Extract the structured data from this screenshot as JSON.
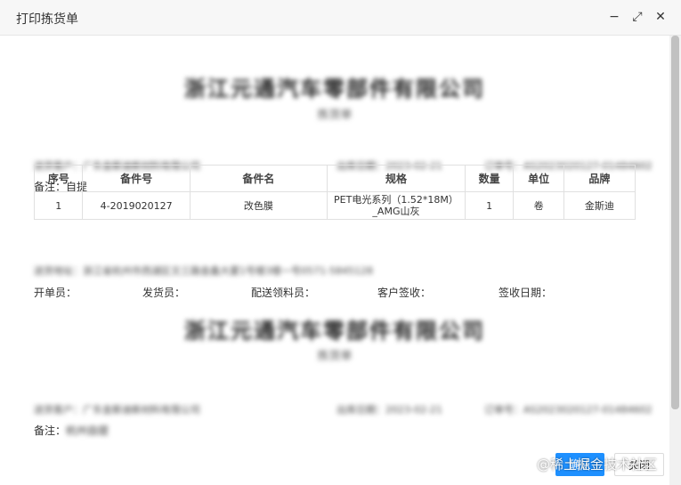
{
  "window": {
    "title": "打印拣货单",
    "minimize_glyph": "−",
    "maximize_glyph": "⤢",
    "close_glyph": "✕"
  },
  "sheets": [
    {
      "company": "浙江元通汽车零部件有限公司",
      "doc_name": "拣货单",
      "delivery_to": "送货客户：广东金斯迪新材料有限公司",
      "date": "出库日期：2023-02-21",
      "order_no": "订单号：AS2023020127-01484602",
      "note_label": "备注：",
      "note_value": "自提",
      "address": "送货地址：浙江省杭州市西湖区文三路金鑫大厦1号楼3楼一号0571-5845128",
      "footer": {
        "issuer": "开单员：",
        "shipper": "发货员：",
        "picker": "配送领料员：",
        "customer_sign": "客户签收：",
        "sign_date": "签收日期："
      }
    },
    {
      "company": "浙江元通汽车零部件有限公司",
      "doc_name": "拣货单",
      "delivery_to": "送货客户：广东金斯迪新材料有限公司",
      "date": "出库日期：2023-02-21",
      "order_no": "订单号：AS2023020127-01484602",
      "note_label": "备注：",
      "note_value": "杭州自提"
    }
  ],
  "table": {
    "headers": [
      "序号",
      "备件号",
      "备件名",
      "规格",
      "数量",
      "单位",
      "品牌"
    ],
    "rows": [
      {
        "index": "1",
        "part_no": "4-2019020127",
        "part_name": "改色膜",
        "spec_line1": "PET电光系列（1.52*18M）",
        "spec_line2": "_AMG山灰",
        "qty": "1",
        "unit": "卷",
        "brand": "金斯迪"
      }
    ]
  },
  "buttons": {
    "confirm": "确认",
    "close": "关闭"
  },
  "watermark": "@稀土掘金技术社区"
}
